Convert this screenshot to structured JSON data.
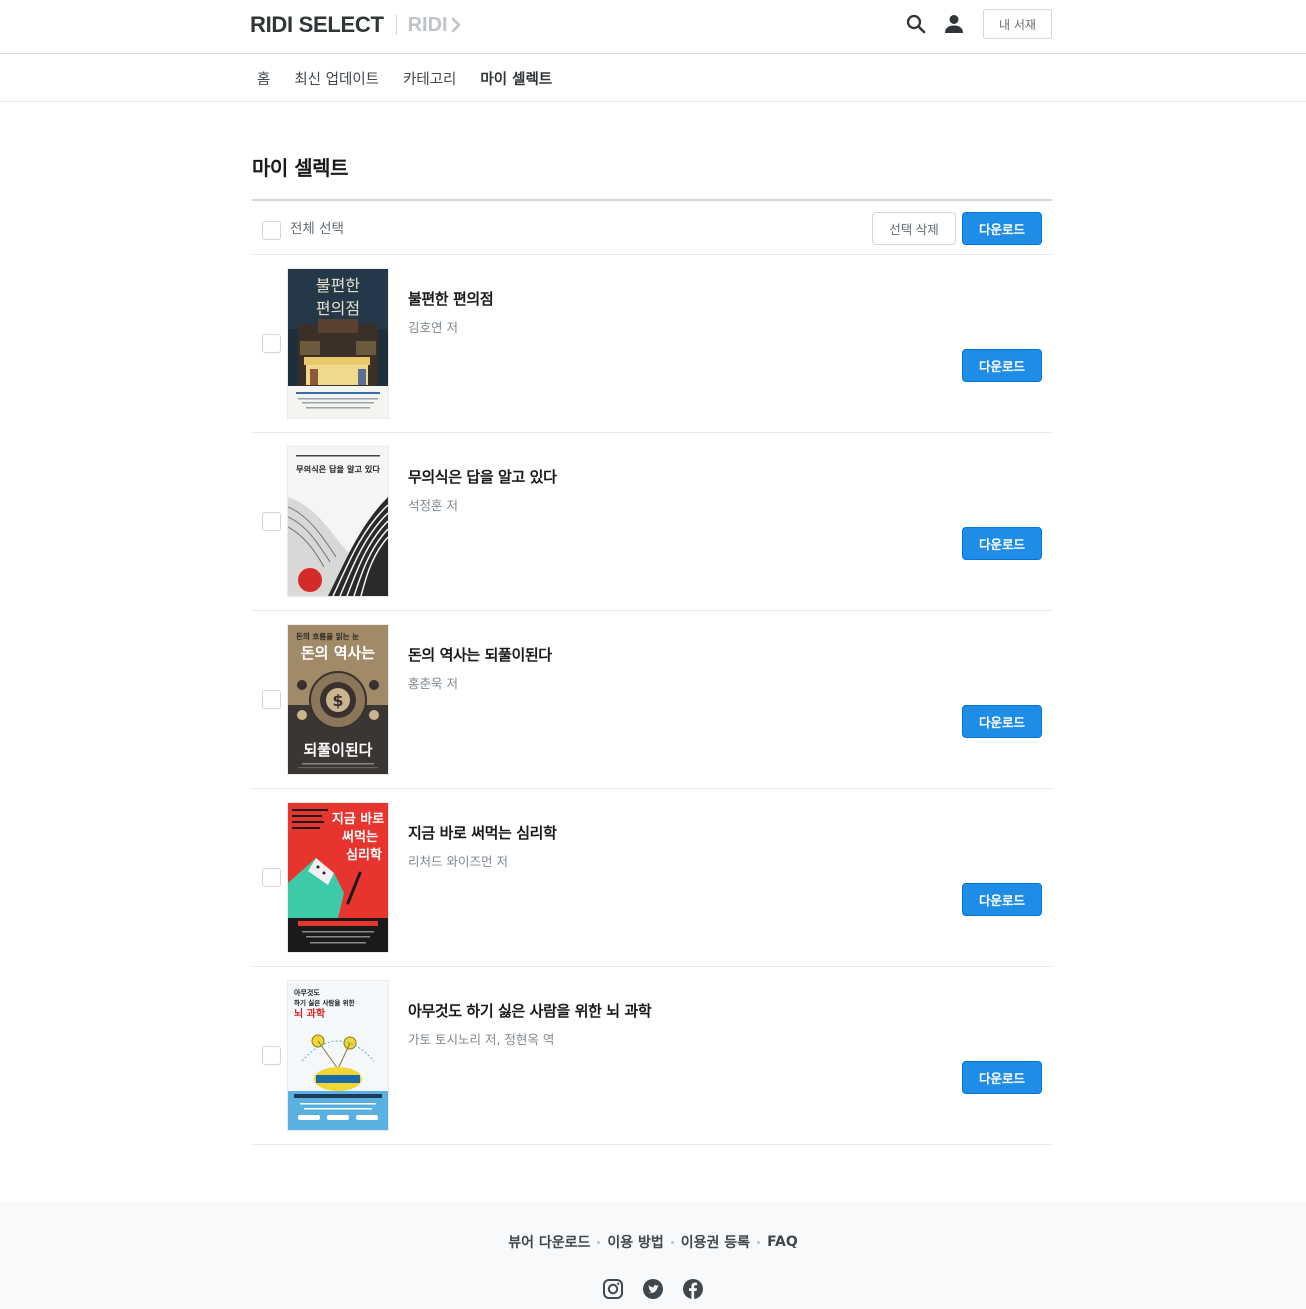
{
  "header": {
    "logo_text": "RIDI SELECT",
    "ridi_link": "RIDI",
    "my_library_label": "내 서재",
    "icons": [
      "search-icon",
      "user-icon"
    ]
  },
  "nav": {
    "items": [
      {
        "label": "홈",
        "active": false
      },
      {
        "label": "최신 업데이트",
        "active": false
      },
      {
        "label": "카테고리",
        "active": false
      },
      {
        "label": "마이 셀렉트",
        "active": true
      }
    ]
  },
  "page": {
    "title": "마이 셀렉트",
    "select_all_label": "전체 선택",
    "delete_selected_label": "선택 삭제",
    "download_label": "다운로드"
  },
  "books": [
    {
      "title": "불편한 편의점",
      "author": "김호연 저",
      "download_label": "다운로드",
      "cover_text": [
        "불편한",
        "편의점",
        "불편한데 자꾸 가고 싶은 편의점이 있다!"
      ]
    },
    {
      "title": "무의식은 답을 알고 있다",
      "author": "석정훈 저",
      "download_label": "다운로드",
      "cover_text": [
        "무의식은 답을 알고 있다"
      ]
    },
    {
      "title": "돈의 역사는 되풀이된다",
      "author": "홍춘욱 저",
      "download_label": "다운로드",
      "cover_text": [
        "돈의 흐름을 읽는 눈",
        "돈의 역사는",
        "되풀이된다"
      ]
    },
    {
      "title": "지금 바로 써먹는 심리학",
      "author": "리처드 와이즈먼 저",
      "download_label": "다운로드",
      "cover_text": [
        "지금 바로",
        "써먹는",
        "심리학"
      ]
    },
    {
      "title": "아무것도 하기 싫은 사람을 위한 뇌 과학",
      "author": "가토 토시노리 저, 정현옥 역",
      "download_label": "다운로드",
      "cover_text": [
        "아무것도",
        "하기 싫은 사람을 위한",
        "뇌 과학"
      ]
    }
  ],
  "footer": {
    "links": [
      "뷰어 다운로드",
      "이용 방법",
      "이용권 등록",
      "FAQ"
    ],
    "social_icons": [
      "instagram-icon",
      "twitter-icon",
      "facebook-icon"
    ]
  },
  "colors": {
    "accent": "#1f8ce6",
    "text": "#303538",
    "muted": "#808991",
    "divider": "#e6e8eb",
    "footer_bg": "#f7f9fa"
  }
}
